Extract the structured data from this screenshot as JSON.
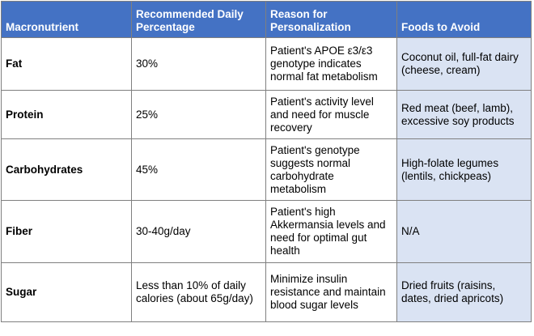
{
  "table": {
    "headers": {
      "macronutrient": "Macronutrient",
      "percentage": "Recommended Daily Percentage",
      "reason": "Reason for Personalization",
      "avoid": "Foods to Avoid"
    },
    "rows": [
      {
        "name": "Fat",
        "percentage": "30%",
        "reason": "Patient's APOE ε3/ε3 genotype indicates normal fat metabolism",
        "avoid": "Coconut oil, full-fat dairy (cheese, cream)"
      },
      {
        "name": "Protein",
        "percentage": "25%",
        "reason": "Patient's activity level and need for muscle recovery",
        "avoid": "Red meat (beef, lamb), excessive soy products"
      },
      {
        "name": "Carbohydrates",
        "percentage": "45%",
        "reason": "Patient's genotype suggests normal carbohydrate metabolism",
        "avoid": "High-folate legumes (lentils, chickpeas)"
      },
      {
        "name": "Fiber",
        "percentage": "30-40g/day",
        "reason": "Patient's high Akkermansia levels and need for optimal gut health",
        "avoid": "N/A"
      },
      {
        "name": "Sugar",
        "percentage": "Less than 10% of daily calories (about 65g/day)",
        "reason": "Minimize insulin resistance and maintain blood sugar levels",
        "avoid": "Dried fruits (raisins, dates, dried apricots)"
      }
    ]
  }
}
